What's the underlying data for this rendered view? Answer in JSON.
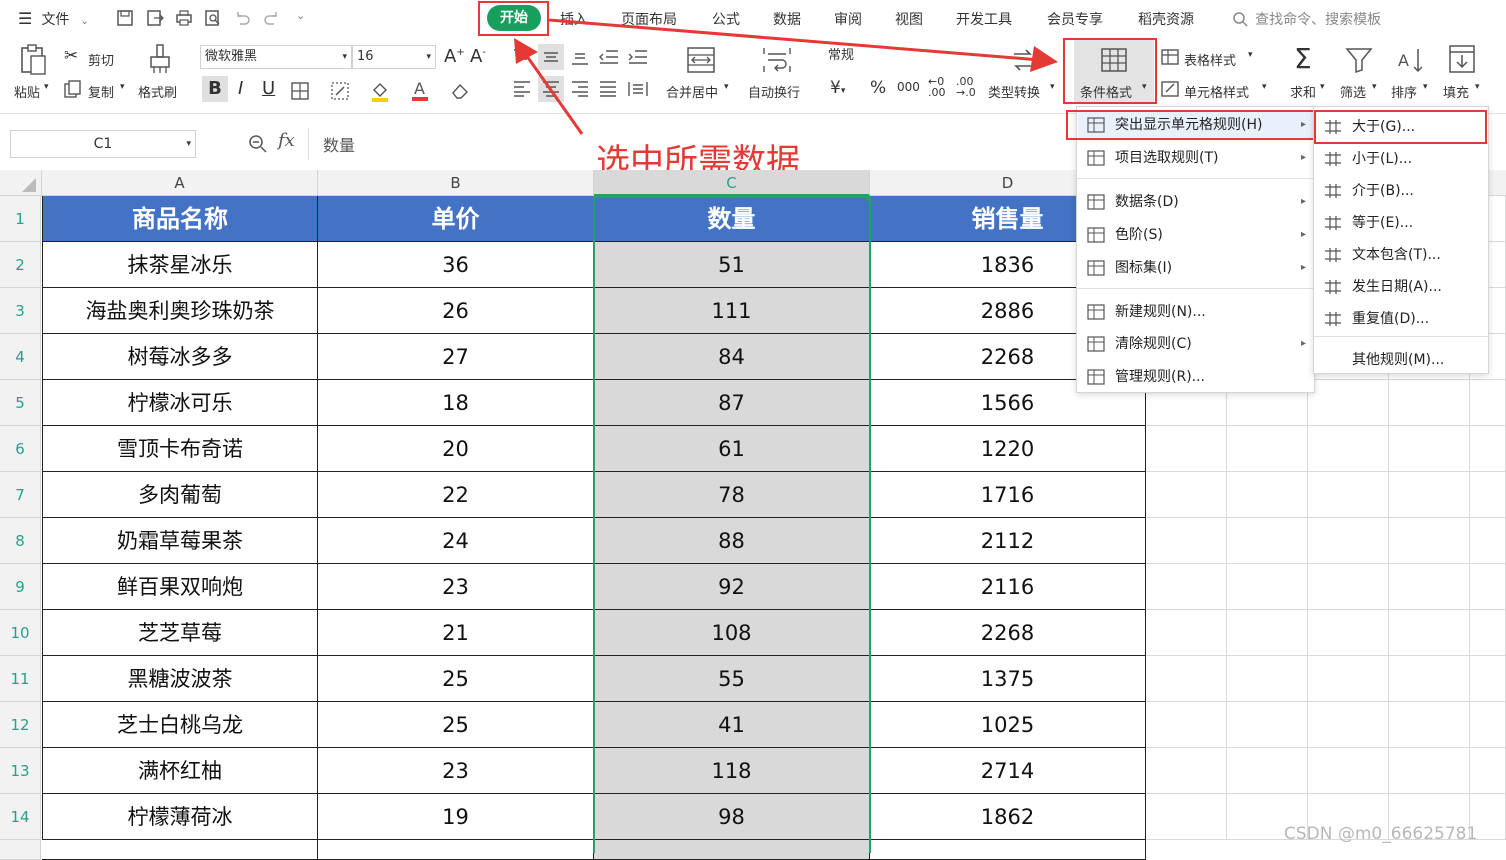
{
  "menubar": {
    "file_label": "文件",
    "tabs": [
      "开始",
      "插入",
      "页面布局",
      "公式",
      "数据",
      "审阅",
      "视图",
      "开发工具",
      "会员专享",
      "稻壳资源"
    ],
    "search_placeholder": "查找命令、搜索模板"
  },
  "ribbon": {
    "paste": "粘贴",
    "cut": "剪切",
    "copy": "复制",
    "format_painter": "格式刷",
    "font_name": "微软雅黑",
    "font_size": "16",
    "merge_center": "合并居中",
    "wrap_text": "自动换行",
    "number_format": "常规",
    "type_convert": "类型转换",
    "conditional_format": "条件格式",
    "table_style": "表格样式",
    "cell_style": "单元格样式",
    "sum": "求和",
    "filter": "筛选",
    "sort": "排序",
    "fill": "填充"
  },
  "formula_bar": {
    "name_box": "C1",
    "fx": "fx",
    "content": "数量"
  },
  "annotation": {
    "text": "选中所需数据"
  },
  "sheet": {
    "columns": [
      "A",
      "B",
      "C",
      "D"
    ],
    "header": [
      "商品名称",
      "单价",
      "数量",
      "销售量"
    ],
    "rows": [
      [
        "抹茶星冰乐",
        "36",
        "51",
        "1836"
      ],
      [
        "海盐奥利奥珍珠奶茶",
        "26",
        "111",
        "2886"
      ],
      [
        "树莓冰多多",
        "27",
        "84",
        "2268"
      ],
      [
        "柠檬冰可乐",
        "18",
        "87",
        "1566"
      ],
      [
        "雪顶卡布奇诺",
        "20",
        "61",
        "1220"
      ],
      [
        "多肉葡萄",
        "22",
        "78",
        "1716"
      ],
      [
        "奶霜草莓果茶",
        "24",
        "88",
        "2112"
      ],
      [
        "鲜百果双响炮",
        "23",
        "92",
        "2116"
      ],
      [
        "芝芝草莓",
        "21",
        "108",
        "2268"
      ],
      [
        "黑糖波波茶",
        "25",
        "55",
        "1375"
      ],
      [
        "芝士白桃乌龙",
        "25",
        "41",
        "1025"
      ],
      [
        "满杯红柚",
        "23",
        "118",
        "2714"
      ],
      [
        "柠檬薄荷冰",
        "19",
        "98",
        "1862"
      ]
    ],
    "row_numbers": [
      "1",
      "2",
      "3",
      "4",
      "5",
      "6",
      "7",
      "8",
      "9",
      "10",
      "11",
      "12",
      "13",
      "14"
    ]
  },
  "menu_main": {
    "items": [
      {
        "label": "突出显示单元格规则(H)",
        "icon": "highlight-rules-icon",
        "submenu": true
      },
      {
        "label": "项目选取规则(T)",
        "icon": "top-bottom-rules-icon",
        "submenu": true
      },
      {
        "label": "数据条(D)",
        "icon": "data-bars-icon",
        "submenu": true
      },
      {
        "label": "色阶(S)",
        "icon": "color-scales-icon",
        "submenu": true
      },
      {
        "label": "图标集(I)",
        "icon": "icon-sets-icon",
        "submenu": true
      },
      {
        "label": "新建规则(N)...",
        "icon": "new-rule-icon",
        "submenu": false
      },
      {
        "label": "清除规则(C)",
        "icon": "clear-rules-icon",
        "submenu": true
      },
      {
        "label": "管理规则(R)...",
        "icon": "manage-rules-icon",
        "submenu": false
      }
    ]
  },
  "menu_sub": {
    "items": [
      {
        "label": "大于(G)..."
      },
      {
        "label": "小于(L)..."
      },
      {
        "label": "介于(B)..."
      },
      {
        "label": "等于(E)..."
      },
      {
        "label": "文本包含(T)..."
      },
      {
        "label": "发生日期(A)..."
      },
      {
        "label": "重复值(D)..."
      },
      {
        "label": "其他规则(M)..."
      }
    ]
  },
  "watermark": "CSDN @m0_66625781",
  "colors": {
    "accent_green": "#17a05d",
    "header_blue": "#4472c4",
    "annotation_red": "#e53935",
    "selection": "#d9d9d9"
  }
}
